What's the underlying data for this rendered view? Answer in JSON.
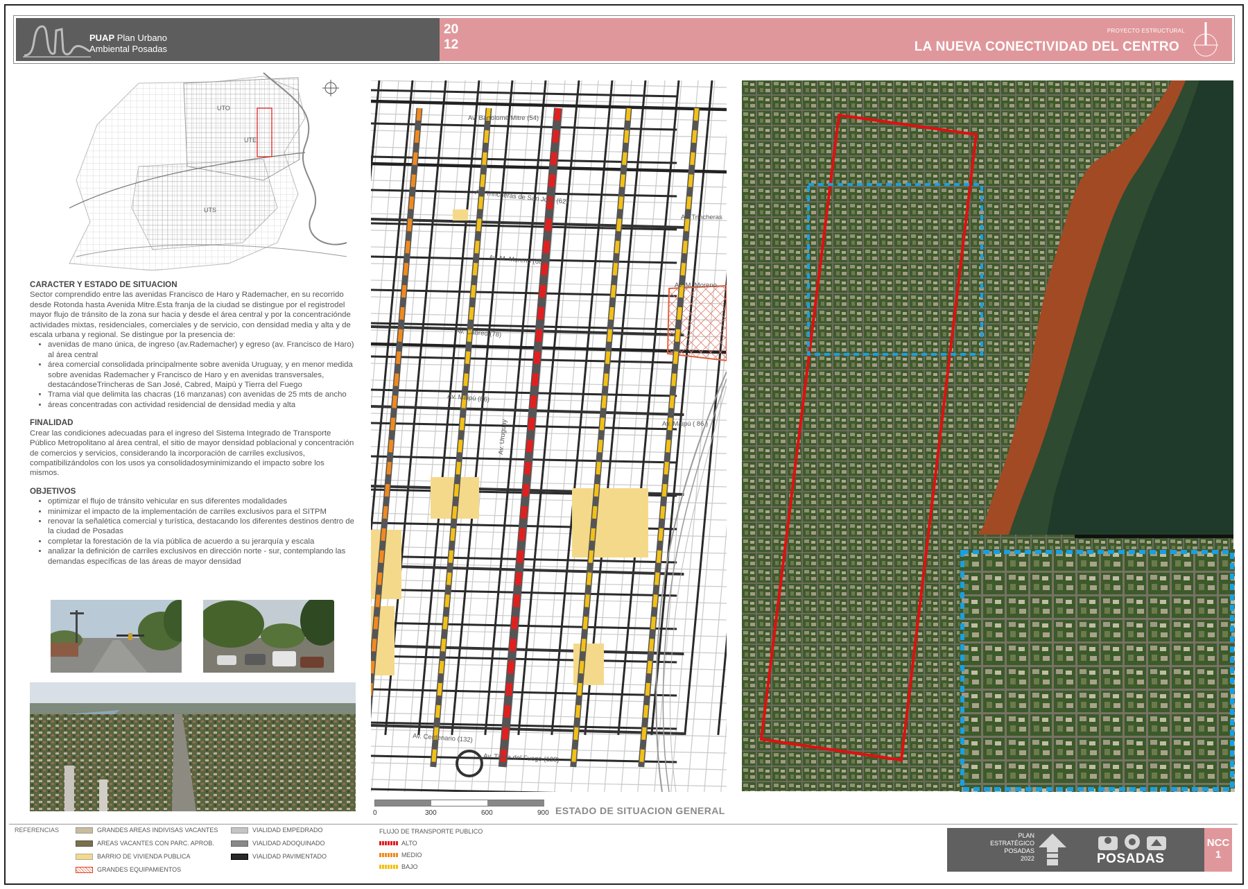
{
  "header": {
    "logo_brand": "PUAP",
    "logo_name_line1": "Plan Urbano",
    "logo_name_line2": "Ambiental Posadas",
    "year_line1": "20",
    "year_line2": "12",
    "kicker": "PROYECTO ESTRUCTURAL",
    "title": "LA NUEVA CONECTIVIDAD DEL CENTRO"
  },
  "location_map": {
    "labels": [
      "UTO",
      "UTE",
      "UTS"
    ]
  },
  "text": {
    "caracter_title": "CARACTER Y ESTADO DE SITUACION",
    "caracter_body": "Sector comprendido entre las avenidas Francisco de Haro y Rademacher, en su recorrido desde Rotonda hasta Avenida Mitre.Esta franja de la ciudad se distingue por el registrodel mayor flujo de tránsito de la zona sur hacia y desde el área central y por la concentraciónde actividades mixtas, residenciales, comerciales y de servicio, con densidad media y alta y de escala urbana y regional. Se distingue por la presencia de:",
    "caracter_items": [
      "avenidas de mano única, de ingreso (av.Rademacher) y egreso (av. Francisco de Haro) al área central",
      "área comercial consolidada principalmente sobre avenida Uruguay, y en menor medida sobre avenidas Rademacher y Francisco de Haro y en avenidas transversales, destacándoseTrincheras de San José, Cabred, Maipú y Tierra del Fuego",
      "Trama vial que delimita las chacras (16 manzanas) con avenidas de 25 mts de ancho",
      "áreas concentradas con actividad residencial de densidad media y alta"
    ],
    "finalidad_title": "FINALIDAD",
    "finalidad_body": "Crear las condiciones adecuadas para el ingreso del Sistema Integrado de Transporte Público Metropolitano al área central, el sitio de mayor densidad poblacional y concentración de comercios y servicios, considerando la incorporación de carriles exclusivos, compatibilizándolos con los usos ya consolidadosyminimizando el impacto sobre los mismos.",
    "objetivos_title": "OBJETIVOS",
    "objetivos_items": [
      "optimizar el flujo de tránsito vehicular en sus diferentes modalidades",
      "minimizar el impacto de la implementación de carriles exclusivos para el SITPM",
      "renovar la señalética comercial y turística, destacando los diferentes destinos dentro de la ciudad de Posadas",
      "completar la forestación de la vía pública de acuerdo a su jerarquía y escala",
      "analizar la definición de carriles exclusivos en dirección norte - sur, contemplando las demandas específicas de las áreas de mayor densidad"
    ]
  },
  "map": {
    "street_labels": [
      "Av. Bartolomé Mitre (54)",
      "Av. Trincheras de San José (62)",
      "Av. Trincheras",
      "Av. M. Moreno (68)",
      "Av. M. Moreno",
      "Av. Cabred (78)",
      "Av. Maipú (86)",
      "Av. Maipú ( 86 )",
      "Av. Uruguay",
      "Av. Tierra del Fuego (128)",
      "Av. Centenario (132)"
    ],
    "scale_labels": [
      "0",
      "300",
      "600",
      "900"
    ],
    "caption": "ESTADO DE SITUACION GENERAL"
  },
  "legend": {
    "title": "REFERENCIAS",
    "items": [
      {
        "label": "GRANDES AREAS INDIVISAS VACANTES",
        "color": "#c8bd9c"
      },
      {
        "label": "AREAS VACANTES CON PARC. APROB.",
        "color": "#7c7048"
      },
      {
        "label": "BARRIO DE VIVIENDA PUBLICA",
        "color": "#f5d98a"
      },
      {
        "label": "GRANDES EQUIPAMIENTOS",
        "color": "#e87a60"
      },
      {
        "label": "VIALIDAD EMPEDRADO",
        "color": "#c4c4c4"
      },
      {
        "label": "VIALIDAD ADOQUINADO",
        "color": "#888888"
      },
      {
        "label": "VIALIDAD PAVIMENTADO",
        "color": "#2a2a2a"
      }
    ],
    "flujo_title": "FLUJO DE TRANSPORTE PUBLICO",
    "flujo_items": [
      {
        "label": "ALTO",
        "color": "#e02020"
      },
      {
        "label": "MEDIO",
        "color": "#f08a20"
      },
      {
        "label": "BAJO",
        "color": "#f2c018"
      }
    ]
  },
  "footer": {
    "plan_lines": [
      "PLAN",
      "ESTRATÉGICO",
      "POSADAS",
      "2022"
    ],
    "city": "POSADAS",
    "code_line1": "NCC",
    "code_line2": "1"
  },
  "colors": {
    "header_gray": "#5d5d5d",
    "header_pink": "#e0979b",
    "alto": "#e02020",
    "medio": "#f08a20",
    "bajo": "#f2c018",
    "boundary_red": "#e01010",
    "zoom_blue": "#1aa0e0"
  }
}
